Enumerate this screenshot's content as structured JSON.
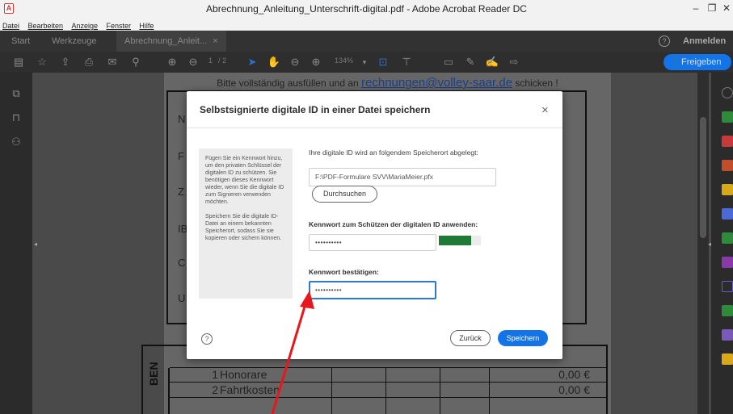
{
  "window": {
    "title": "Abrechnung_Anleitung_Unterschrift-digital.pdf - Adobe Acrobat Reader DC",
    "app_icon_glyph": "A",
    "controls": [
      "–",
      "❐",
      "✕"
    ]
  },
  "menu": [
    "Datei",
    "Bearbeiten",
    "Anzeige",
    "Fenster",
    "Hilfe"
  ],
  "tabs": {
    "start": "Start",
    "tools": "Werkzeuge",
    "document": "Abrechnung_Anleit...",
    "document_close": "×",
    "sign_in": "Anmelden",
    "help_glyph": "?"
  },
  "toolbar": {
    "page_current": "1",
    "page_total": "/ 2",
    "zoom": "134%",
    "share_label": "Freigeben",
    "icons": [
      "save-icon",
      "bookmark-star-icon",
      "upload-cloud-icon",
      "print-icon",
      "email-icon",
      "search-icon",
      "page-up-icon",
      "page-down-icon",
      "select-arrow-icon",
      "hand-icon",
      "zoom-out-icon",
      "zoom-in-icon",
      "fit-page-icon",
      "scroll-mode-icon",
      "comment-icon",
      "pen-icon",
      "sign-icon",
      "share-tool-icon"
    ]
  },
  "document": {
    "instruction": "Bitte vollständig ausfüllen und an",
    "email": "rechnungen@volley-saar.de",
    "instruction_end": "schicken !",
    "row_letters": [
      "N",
      "F",
      "Z",
      "IB",
      "C",
      "U"
    ],
    "table": {
      "vertical_header": "BEN",
      "rows": [
        {
          "num": "1",
          "label": "Honorare",
          "amount": "0,00 €"
        },
        {
          "num": "2",
          "label": "Fahrtkosten",
          "amount": "0,00 €"
        }
      ]
    }
  },
  "dialog": {
    "title": "Selbstsignierte digitale ID in einer Datei speichern",
    "close_glyph": "×",
    "info_paragraph_1": "Fügen Sie ein Kennwort hinzu, um den privaten Schlüssel der digitalen ID zu schützen. Sie benötigen dieses Kennwort wieder, wenn Sie die digitale ID zum Signieren verwenden möchten.",
    "info_paragraph_2": "Speichern Sie die digitale ID-Datei an einem bekannten Speicherort, sodass Sie sie kopieren oder sichern können.",
    "location_label": "Ihre digitale ID wird an folgendem Speicherort abgelegt:",
    "location_value": "F:\\PDF-Formulare SVV\\MariaMeier.pfx",
    "browse_label": "Durchsuchen",
    "password_label": "Kennwort zum Schützen der digitalen ID anwenden:",
    "password_value": "••••••••••",
    "strength_level": 0.77,
    "strength_color": "#1e7a35",
    "confirm_label": "Kennwort bestätigen:",
    "confirm_value": "••••••••••",
    "help_glyph": "?",
    "back_label": "Zurück",
    "save_label": "Speichern"
  },
  "colors": {
    "accent_blue": "#1473e6",
    "annotation_arrow": "#e8171b",
    "field_focus": "#2d78d6"
  }
}
